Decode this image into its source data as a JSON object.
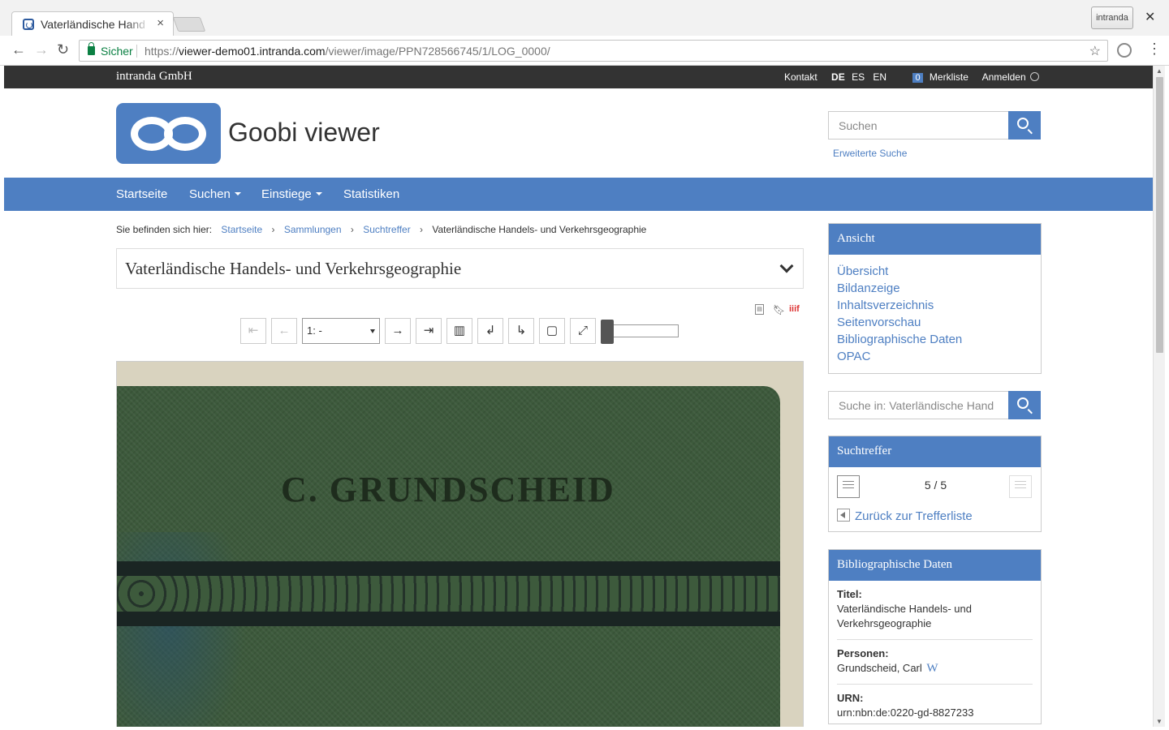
{
  "browser": {
    "tab_title": "Vaterländische Hand",
    "tab_close": "×",
    "profile_label": "intranda",
    "window_close": "✕",
    "secure_label": "Sicher",
    "url_scheme": "https://",
    "url_host": "viewer-demo01.intranda.com",
    "url_path": "/viewer/image/PPN728566745/1/LOG_0000/"
  },
  "topbar": {
    "company": "intranda GmbH",
    "contact": "Kontakt",
    "lang_de": "DE",
    "lang_es": "ES",
    "lang_en": "EN",
    "bookmark_count": "0",
    "bookmarks": "Merkliste",
    "login": "Anmelden"
  },
  "header": {
    "site_title": "Goobi viewer",
    "search_placeholder": "Suchen",
    "advanced_search": "Erweiterte Suche"
  },
  "nav": {
    "home": "Startseite",
    "search": "Suchen",
    "entries": "Einstiege",
    "statistics": "Statistiken"
  },
  "breadcrumb": {
    "prefix": "Sie befinden sich hier:",
    "items": [
      "Startseite",
      "Sammlungen",
      "Suchtreffer",
      "Vaterländische Handels- und Verkehrsgeographie"
    ]
  },
  "document": {
    "title": "Vaterländische Handels- und Verkehrsgeographie"
  },
  "viewer_toolbar": {
    "page_select": "1: -",
    "zoom_level": 0
  },
  "cover": {
    "author_name": "C. GRUNDSCHEID"
  },
  "sidebar": {
    "view": {
      "heading": "Ansicht",
      "items": [
        "Übersicht",
        "Bildanzeige",
        "Inhaltsverzeichnis",
        "Seitenvorschau",
        "Bibliographische Daten",
        "OPAC"
      ]
    },
    "doc_search_placeholder": "Suche in: Vaterländische Hand",
    "hits": {
      "heading": "Suchtreffer",
      "count": "5 / 5",
      "back": "Zurück zur Trefferliste"
    },
    "biblio": {
      "heading": "Bibliographische Daten",
      "title_label": "Titel:",
      "title_value": "Vaterländische Handels- und Verkehrsgeographie",
      "persons_label": "Personen:",
      "persons_value": "Grundscheid, Carl",
      "wiki_mark": "W",
      "urn_label": "URN:",
      "urn_value": "urn:nbn:de:0220-gd-8827233"
    }
  },
  "colors": {
    "accent": "#4e7fc2",
    "topbar": "#333333",
    "secure_green": "#0b8043"
  }
}
